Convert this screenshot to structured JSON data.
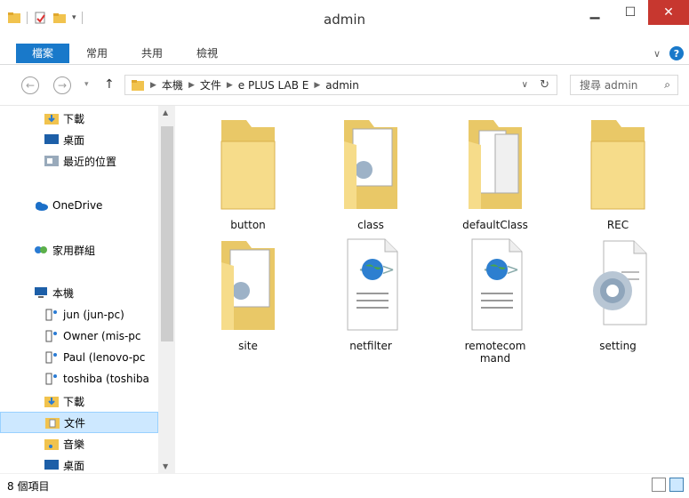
{
  "window": {
    "title": "admin"
  },
  "ribbon": {
    "tabs": [
      "檔案",
      "常用",
      "共用",
      "檢視"
    ]
  },
  "address": {
    "path": [
      "本機",
      "文件",
      "e PLUS LAB E",
      "admin"
    ],
    "search_placeholder": "搜尋 admin"
  },
  "nav": {
    "items": [
      {
        "label": "下載",
        "icon": "download-folder-icon"
      },
      {
        "label": "桌面",
        "icon": "desktop-icon"
      },
      {
        "label": "最近的位置",
        "icon": "recent-places-icon"
      },
      {
        "label": "OneDrive",
        "icon": "onedrive-icon"
      },
      {
        "label": "家用群組",
        "icon": "homegroup-icon"
      },
      {
        "label": "本機",
        "icon": "this-pc-icon"
      },
      {
        "label": "jun (jun-pc)",
        "icon": "network-user-icon"
      },
      {
        "label": "Owner (mis-pc",
        "icon": "network-user-icon"
      },
      {
        "label": "Paul (lenovo-pc",
        "icon": "network-user-icon"
      },
      {
        "label": "toshiba (toshiba",
        "icon": "network-user-icon"
      },
      {
        "label": "下載",
        "icon": "download-folder-icon"
      },
      {
        "label": "文件",
        "icon": "documents-folder-icon"
      },
      {
        "label": "音樂",
        "icon": "music-folder-icon"
      },
      {
        "label": "桌面",
        "icon": "desktop-icon"
      }
    ]
  },
  "files": [
    {
      "name": "button",
      "type": "folder"
    },
    {
      "name": "class",
      "type": "folder-docs"
    },
    {
      "name": "defaultClass",
      "type": "folder-docs"
    },
    {
      "name": "REC",
      "type": "folder"
    },
    {
      "name": "site",
      "type": "folder-docs"
    },
    {
      "name": "netfilter",
      "type": "html-file"
    },
    {
      "name": "remotecommand",
      "type": "html-file"
    },
    {
      "name": "setting",
      "type": "config-file"
    }
  ],
  "status": {
    "count": "8 個項目"
  },
  "colors": {
    "accent": "#1979ca",
    "folder": "#f5d77b",
    "selection": "#cde8ff",
    "close": "#c7372f"
  }
}
